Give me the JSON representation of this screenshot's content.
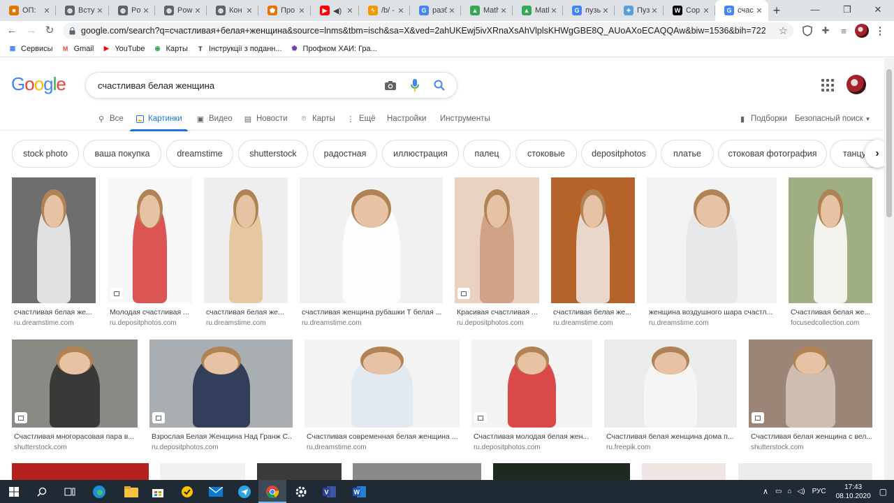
{
  "browser": {
    "tabs": [
      {
        "title": "ОП:",
        "fav_color": "#e37400",
        "fav_glyph": "■"
      },
      {
        "title": "Всту",
        "fav_color": "#5f6368",
        "fav_glyph": "◍"
      },
      {
        "title": "Pow",
        "fav_color": "#5f6368",
        "fav_glyph": "◍"
      },
      {
        "title": "Pow",
        "fav_color": "#5f6368",
        "fav_glyph": "◍"
      },
      {
        "title": "Кон",
        "fav_color": "#5f6368",
        "fav_glyph": "◍"
      },
      {
        "title": "Про",
        "fav_color": "#e8710a",
        "fav_glyph": "⬟"
      },
      {
        "title": "◀)",
        "fav_color": "#ff0000",
        "fav_glyph": "▶"
      },
      {
        "title": "/b/ -",
        "fav_color": "#f29900",
        "fav_glyph": "ϟ"
      },
      {
        "title": "разб",
        "fav_color": "#4285f4",
        "fav_glyph": "G"
      },
      {
        "title": "Math",
        "fav_color": "#34a853",
        "fav_glyph": "▲"
      },
      {
        "title": "Math",
        "fav_color": "#34a853",
        "fav_glyph": "▲"
      },
      {
        "title": "пузы",
        "fav_color": "#4285f4",
        "fav_glyph": "G"
      },
      {
        "title": "Пузы",
        "fav_color": "#5aa0d8",
        "fav_glyph": "✦"
      },
      {
        "title": "Сор",
        "fav_color": "#000000",
        "fav_glyph": "W"
      },
      {
        "title": "счас",
        "fav_color": "#4285f4",
        "fav_glyph": "G"
      }
    ],
    "window_controls": {
      "minimize": "—",
      "maximize": "❐",
      "close": "✕"
    },
    "url": "google.com/search?q=счастливая+белая+женщина&source=lnms&tbm=isch&sa=X&ved=2ahUKEwj5ivXRnaXsAhVlplsKHWgGBE8Q_AUoAXoECAQQAw&biw=1536&bih=722",
    "bookmarks": [
      {
        "label": "Сервисы",
        "icon": "apps-icon"
      },
      {
        "label": "Gmail",
        "icon": "gmail-icon"
      },
      {
        "label": "YouTube",
        "icon": "youtube-icon"
      },
      {
        "label": "Карты",
        "icon": "maps-icon"
      },
      {
        "label": "Інструкції з поданн...",
        "icon": "t-icon"
      },
      {
        "label": "Профком ХАИ: Гра...",
        "icon": "profkom-icon"
      }
    ]
  },
  "google": {
    "logo": "Google",
    "query": "счастливая белая женщина",
    "tabs": [
      {
        "label": "Все",
        "icon": "search-icon"
      },
      {
        "label": "Картинки",
        "icon": "image-icon",
        "active": true
      },
      {
        "label": "Видео",
        "icon": "video-icon"
      },
      {
        "label": "Новости",
        "icon": "news-icon"
      },
      {
        "label": "Карты",
        "icon": "map-pin-icon"
      },
      {
        "label": "Ещё",
        "icon": "more-icon"
      },
      {
        "label": "Настройки"
      },
      {
        "label": "Инструменты"
      }
    ],
    "collections_label": "Подборки",
    "safe_search_label": "Безопасный поиск",
    "chips": [
      "stock photo",
      "ваша покупка",
      "dreamstime",
      "shutterstock",
      "радостная",
      "иллюстрация",
      "палец",
      "стоковые",
      "depositphotos",
      "платье",
      "стоковая фотография",
      "танцу"
    ],
    "row1": [
      {
        "caption": "счастливая белая же...",
        "source": "ru.dreamstime.com",
        "bg": "#6e6e6e",
        "fg": "#f4f4f4",
        "badge": false
      },
      {
        "caption": "Молодая счастливая ...",
        "source": "ru.depositphotos.com",
        "bg": "#f7f7f7",
        "fg": "#d63a35",
        "badge": true
      },
      {
        "caption": "счастливая белая же...",
        "source": "ru.dreamstime.com",
        "bg": "#eeeeee",
        "fg": "#e3c093",
        "badge": false
      },
      {
        "caption": "счастливая женщина рубашки Т белая ...",
        "source": "ru.dreamstime.com",
        "bg": "#f1f1f1",
        "fg": "#ffffff",
        "badge": false
      },
      {
        "caption": "Красивая счастливая ...",
        "source": "ru.depositphotos.com",
        "bg": "#e9d2c2",
        "fg": "#cc9a7e",
        "badge": true
      },
      {
        "caption": "счастливая белая же...",
        "source": "ru.dreamstime.com",
        "bg": "#b6622b",
        "fg": "#f1ece6",
        "badge": false
      },
      {
        "caption": "женщина воздушного шара счастл...",
        "source": "ru.dreamstime.com",
        "bg": "#f2f2f2",
        "fg": "#e6e6e6",
        "badge": false
      },
      {
        "caption": "Счастливая белая же...",
        "source": "focusedcollection.com",
        "bg": "#9fae83",
        "fg": "#ffffff",
        "badge": false
      }
    ],
    "row2": [
      {
        "caption": "Счастливая многорасовая пара в...",
        "source": "shutterstock.com",
        "bg": "#8a8a84",
        "fg": "#2a2a2a",
        "badge": true
      },
      {
        "caption": "Взрослая Белая Женщина Над Гранж С...",
        "source": "ru.depositphotos.com",
        "bg": "#a9aeb2",
        "fg": "#1f2b4a",
        "badge": true
      },
      {
        "caption": "Счастливая современная белая женщина ...",
        "source": "ru.dreamstime.com",
        "bg": "#f3f3f3",
        "fg": "#dfe6ef",
        "badge": false
      },
      {
        "caption": "Счастливая молодая белая жен...",
        "source": "ru.depositphotos.com",
        "bg": "#f3f3f3",
        "fg": "#d42a2a",
        "badge": true
      },
      {
        "caption": "Счастливая белая женщина дома п...",
        "source": "ru.freepik.com",
        "bg": "#e9ece8",
        "fg": "#f7f7f7",
        "badge": false
      },
      {
        "caption": "Счастливая белая женщина с вел...",
        "source": "shutterstock.com",
        "bg": "#9a8577",
        "fg": "#d8c8b8",
        "badge": true
      }
    ],
    "row3": [
      {
        "bg": "#b5211c"
      },
      {
        "bg": "#f1f1f1"
      },
      {
        "bg": "#3a3a3a"
      },
      {
        "bg": "#8a8a8a"
      },
      {
        "bg": "#1e2a1e"
      },
      {
        "bg": "#efe6e3"
      },
      {
        "bg": "#ececec"
      }
    ]
  },
  "taskbar": {
    "apps": [
      "start-icon",
      "search-icon",
      "task-view-icon",
      "edge-icon",
      "explorer-icon",
      "store-icon",
      "norton-icon",
      "mail-icon",
      "telegram-icon",
      "chrome-icon",
      "settings-icon",
      "visio-icon",
      "word-icon"
    ],
    "lang": "РУС",
    "time": "17:43",
    "date": "08.10.2020"
  }
}
